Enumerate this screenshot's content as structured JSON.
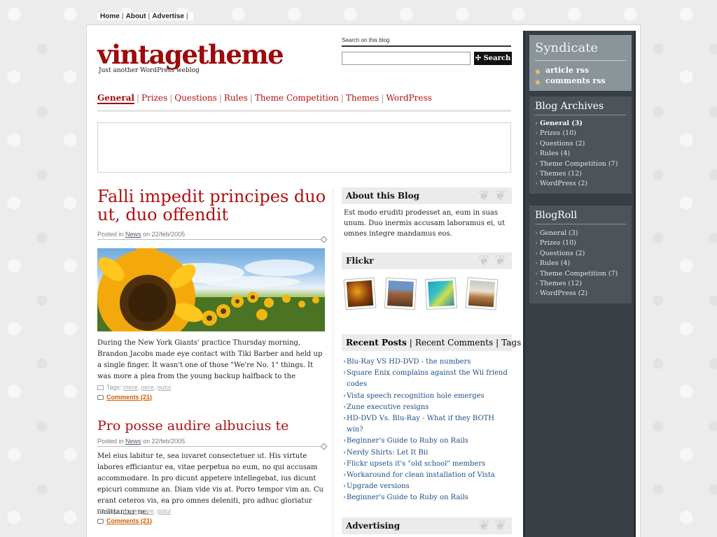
{
  "topnav": {
    "items": [
      "Home",
      "About",
      "Advertise"
    ]
  },
  "header": {
    "title": "vintagetheme",
    "tagline": "Just another WordPress weblog"
  },
  "search": {
    "label": "Search on this blog",
    "button": "Search"
  },
  "catnav": {
    "items": [
      "General",
      "Prizes",
      "Questions",
      "Rules",
      "Theme Competition",
      "Themes",
      "WordPress"
    ]
  },
  "posts": [
    {
      "title": "Falli impedit principes duo ut, duo offendit",
      "meta_prefix": "Posted in",
      "category": "News",
      "meta_on": "on",
      "date": "22/feb/2005",
      "body": "During the New York Giants' practice Thursday morning, Brandon Jacobs made eye contact with Tiki Barber and held up a single finger. It wasn't one of those \"We're No. 1\" things. It was more a plea from the young backup halfback to the",
      "tags_label": "Tags:",
      "tags": [
        "mere",
        "pere",
        "gutui"
      ],
      "comments": "Comments (21)"
    },
    {
      "title": "Pro posse audire albucius te",
      "meta_prefix": "Posted in",
      "category": "News",
      "meta_on": "on",
      "date": "22/feb/2005",
      "body": "Mel eius labitur te, sea iuvaret consectetuer ut. His virtute labores efficiantur ea, vitae perpetua no eum, no qui accusam accommodare. In pro dicunt appetere intellegebat, ius dicunt epicuri commune an. Diam vide vis at. Porro tempor vim an. Cu erant ceteros vis, ea pro omnes deleniti, pro adhuc gloriatur omittantur ne.",
      "tags_label": "Tags:",
      "tags": [
        "mere",
        "pere",
        "gutui"
      ],
      "comments": "Comments (21)"
    }
  ],
  "widgets": {
    "about": {
      "title": "About this Blog",
      "text": "Est modo eruditi prodesset an, eum in suas unum. Duo inermis accusam laboramus ei, ut omnes integre mandamus eos."
    },
    "flickr": {
      "title": "Flickr"
    },
    "tabs": [
      "Recent Posts",
      "Recent Comments",
      "Tags"
    ],
    "recent_posts": [
      "Blu-Ray VS HD-DVD - the numbers",
      "Square Enix complains against the Wii friend codes",
      "Vista speech recognition hole emerges",
      "Zune executive resigns",
      "HD-DVD Vs. Blu-Ray - What if they BOTH win?",
      "Beginner's Guide to Ruby on Rails",
      "Nerdy Shirts: Let It Bii",
      "Flickr upsets it's \"old school\" members",
      "Workaround for clean installation of Vista",
      "Upgrade versions",
      "Beginner's Guide to Ruby on Rails"
    ],
    "advertising": {
      "title": "Advertising"
    }
  },
  "sidebar": {
    "syndicate": {
      "title": "Syndicate",
      "links": [
        "article rss",
        "comments rss"
      ]
    },
    "archives": {
      "title": "Blog Archives",
      "items": [
        "General (3)",
        "Prizes (10)",
        "Questions (2)",
        "Rules (4)",
        "Theme Competition (7)",
        "Themes (12)",
        "WordPress (2)"
      ]
    },
    "blogroll": {
      "title": "BlogRoll",
      "items": [
        "General (3)",
        "Prizes (10)",
        "Questions (2)",
        "Rules (4)",
        "Theme Competition (7)",
        "Themes (12)",
        "WordPress (2)"
      ]
    }
  },
  "colors": {
    "accent": "#9b0a0a",
    "link": "#1b4f86",
    "comments": "#d05a00",
    "sidebar": "#383f44"
  }
}
